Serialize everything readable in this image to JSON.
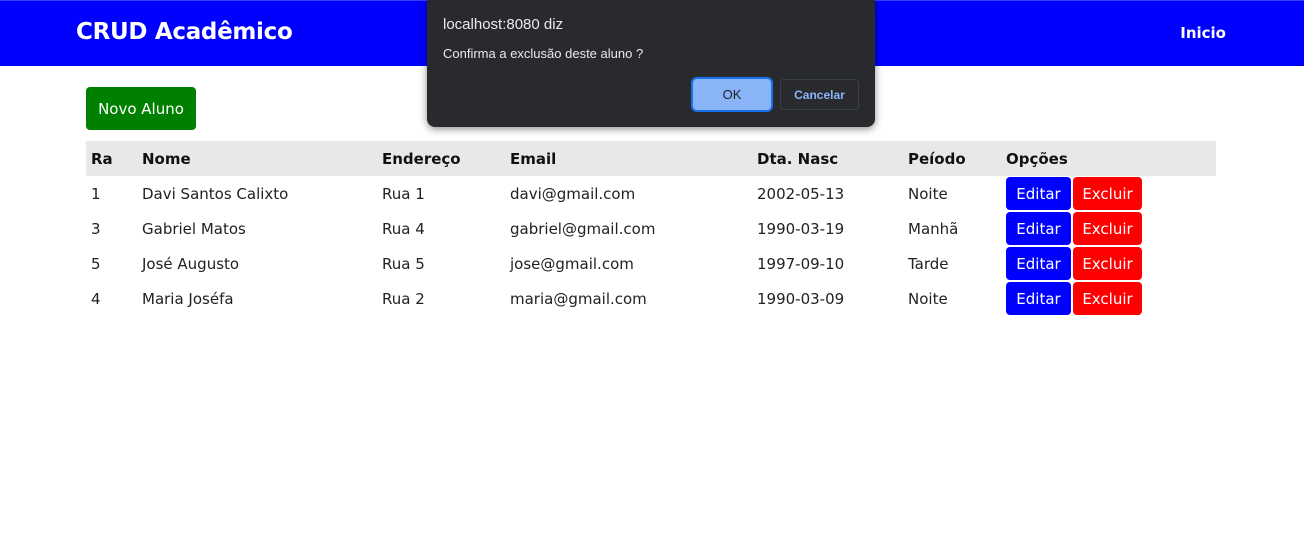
{
  "navbar": {
    "brand": "CRUD Acadêmico",
    "link": "Inicio",
    "color": "#0000ff"
  },
  "new_button": {
    "label": "Novo Aluno",
    "color": "#008000"
  },
  "table": {
    "headers": {
      "ra": "Ra",
      "nome": "Nome",
      "endereco": "Endereço",
      "email": "Email",
      "dta_nasc": "Dta. Nasc",
      "periodo": "Peíodo",
      "opcoes": "Opções"
    },
    "rows": [
      {
        "ra": "1",
        "nome": "Davi Santos Calixto",
        "endereco": "Rua 1",
        "email": "davi@gmail.com",
        "dta_nasc": "2002-05-13",
        "periodo": "Noite",
        "edit": "Editar",
        "delete": "Excluir"
      },
      {
        "ra": "3",
        "nome": "Gabriel Matos",
        "endereco": "Rua 4",
        "email": "gabriel@gmail.com",
        "dta_nasc": "1990-03-19",
        "periodo": "Manhã",
        "edit": "Editar",
        "delete": "Excluir"
      },
      {
        "ra": "5",
        "nome": "José Augusto",
        "endereco": "Rua 5",
        "email": "jose@gmail.com",
        "dta_nasc": "1997-09-10",
        "periodo": "Tarde",
        "edit": "Editar",
        "delete": "Excluir"
      },
      {
        "ra": "4",
        "nome": "Maria Joséfa",
        "endereco": "Rua 2",
        "email": "maria@gmail.com",
        "dta_nasc": "1990-03-09",
        "periodo": "Noite",
        "edit": "Editar",
        "delete": "Excluir"
      }
    ],
    "edit_color": "#0000ff",
    "delete_color": "#ff0000"
  },
  "dialog": {
    "title": "localhost:8080 diz",
    "message": "Confirma a exclusão deste aluno ?",
    "ok_label": "OK",
    "cancel_label": "Cancelar"
  }
}
